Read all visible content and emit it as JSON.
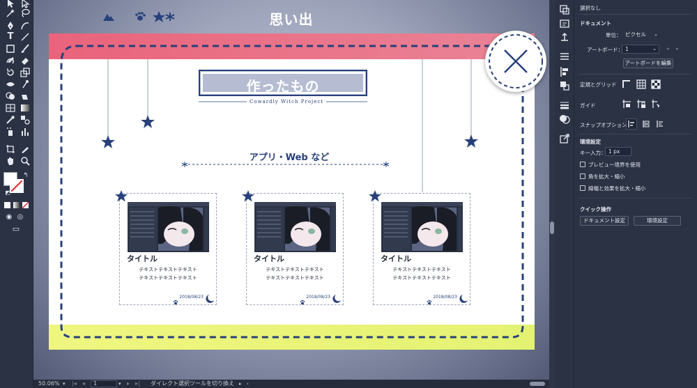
{
  "canvas": {
    "title": "思い出",
    "artboard": {
      "heading": "作ったもの",
      "subtitle": "Cowardly Witch Project",
      "section_heading": "アプリ・Web など",
      "cards": [
        {
          "title": "タイトル",
          "text_line1": "テキストテキストテキスト",
          "text_line2": "テキストテキストテキスト",
          "date": "2018/08/23"
        },
        {
          "title": "タイトル",
          "text_line1": "テキストテキストテキスト",
          "text_line2": "テキストテキストテキスト",
          "date": "2018/08/23"
        },
        {
          "title": "タイトル",
          "text_line1": "テキストテキストテキスト",
          "text_line2": "テキストテキストテキスト",
          "date": "2018/08/23"
        }
      ]
    }
  },
  "status_bar": {
    "zoom": "50.06%",
    "artboard_number": "1",
    "current_tool": "ダイレクト選択ツールを切り換え"
  },
  "properties": {
    "selection": "選択なし",
    "document_header": "ドキュメント",
    "units_label": "単位：",
    "units_value": "ピクセル",
    "artboard_label": "アートボード：",
    "artboard_value": "1",
    "edit_artboard_button": "アートボードを編集",
    "rulers_grid_label": "定規とグリッド",
    "guides_label": "ガイド",
    "snap_label": "スナップオプション",
    "preferences_header": "環境設定",
    "key_increment_label": "キー入力：",
    "key_increment_value": "1 px",
    "checkbox_preview_bounds": "プレビュー境界を使用",
    "checkbox_scale_corners": "角を拡大・縮小",
    "checkbox_scale_strokes": "線幅と効果を拡大・縮小",
    "quick_actions_header": "クイック操作",
    "document_setup_button": "ドキュメント設定",
    "preferences_button": "環境設定"
  },
  "colors": {
    "accent_navy": "#27407a",
    "header_pink": "#e9637b",
    "footer_yellow": "#eff680",
    "panel_bg": "#2b3243"
  }
}
